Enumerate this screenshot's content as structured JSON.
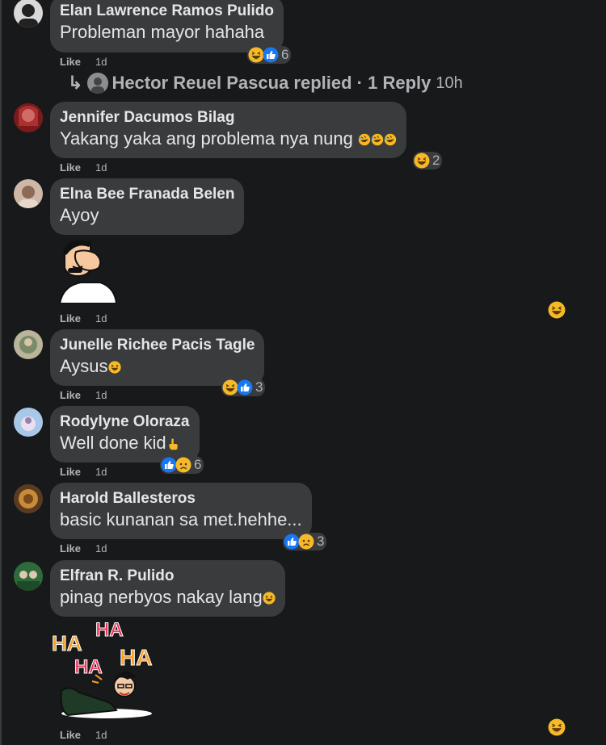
{
  "comments": [
    {
      "name": "Elan Lawrence Ramos Pulido",
      "text": "Probleman mayor hahaha",
      "like": "Like",
      "time": "1d",
      "reaction_count": "6"
    },
    {
      "name": "Jennifer Dacumos Bilag",
      "text": "Yakang yaka ang problema nya nung",
      "like": "Like",
      "time": "1d",
      "reaction_count": "2"
    },
    {
      "name": "Elna Bee Franada Belen",
      "text": "Ayoy",
      "like": "Like",
      "time": "1d"
    },
    {
      "name": "Junelle Richee Pacis Tagle",
      "text": "Aysus",
      "like": "Like",
      "time": "1d",
      "reaction_count": "3"
    },
    {
      "name": "Rodylyne Oloraza",
      "text": "Well done kid",
      "like": "Like",
      "time": "1d",
      "reaction_count": "6"
    },
    {
      "name": "Harold Ballesteros",
      "text": "basic kunanan sa met.hehhe...",
      "like": "Like",
      "time": "1d",
      "reaction_count": "3"
    },
    {
      "name": "Elfran R. Pulido",
      "text": "pinag nerbyos nakay lang",
      "like": "Like",
      "time": "1d"
    }
  ],
  "reply_summary": {
    "arrow": "↳",
    "text": "Hector Reuel Pascua replied · 1 Reply",
    "time": "10h"
  },
  "sticker_haha": {
    "words": [
      "HA",
      "HA",
      "HA",
      "HA"
    ]
  },
  "colors": {
    "bg": "#18191a",
    "bubble": "#3a3b3c",
    "text": "#e4e6eb",
    "meta": "#b0b3b8",
    "like_blue": "#1877f2",
    "emoji_yellow": "#f7b928"
  },
  "icons": [
    "haha-emoji-icon",
    "like-reaction-icon",
    "sad-reaction-icon",
    "laughing-tears-emoji-icon",
    "pointing-hand-emoji-icon"
  ]
}
